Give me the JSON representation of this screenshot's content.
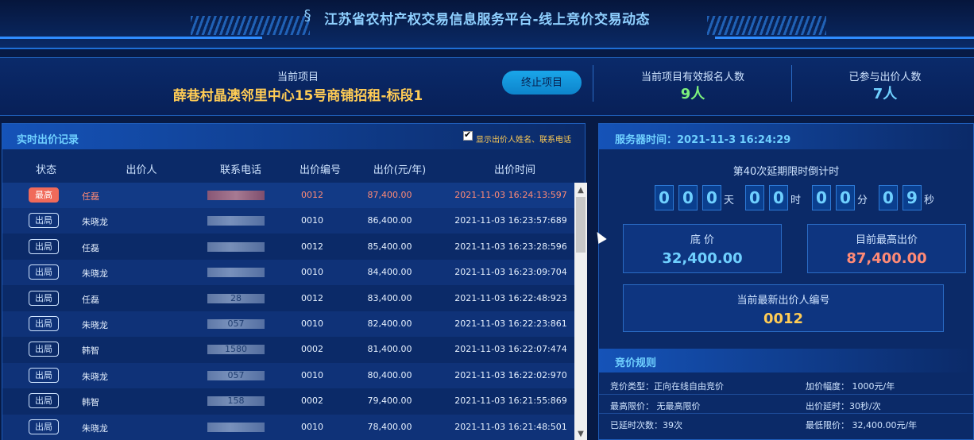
{
  "header": {
    "title": "江苏省农村产权交易信息服务平台-线上竞价交易动态",
    "logo_icon": "s-logo-icon"
  },
  "project": {
    "label": "当前项目",
    "name": "薛巷村晶澳邻里中心15号商铺招租-标段1",
    "end_button": "终止项目",
    "registered_label": "当前项目有效报名人数",
    "registered_value": "9人",
    "bidders_label": "已参与出价人数",
    "bidders_value": "7人"
  },
  "bids": {
    "title": "实时出价记录",
    "show_checkbox_label": "显示出价人姓名、联系电话",
    "columns": [
      "状态",
      "出价人",
      "联系电话",
      "出价编号",
      "出价(元/年)",
      "出价时间"
    ],
    "rows": [
      {
        "status": "最高",
        "bidder": "任磊",
        "phone": "",
        "code": "0012",
        "price": "87,400.00",
        "time": "2021-11-03 16:24:13:597"
      },
      {
        "status": "出局",
        "bidder": "朱晓龙",
        "phone": "",
        "code": "0010",
        "price": "86,400.00",
        "time": "2021-11-03 16:23:57:689"
      },
      {
        "status": "出局",
        "bidder": "任磊",
        "phone": "",
        "code": "0012",
        "price": "85,400.00",
        "time": "2021-11-03 16:23:28:596"
      },
      {
        "status": "出局",
        "bidder": "朱晓龙",
        "phone": "",
        "code": "0010",
        "price": "84,400.00",
        "time": "2021-11-03 16:23:09:704"
      },
      {
        "status": "出局",
        "bidder": "任磊",
        "phone": "28",
        "code": "0012",
        "price": "83,400.00",
        "time": "2021-11-03 16:22:48:923"
      },
      {
        "status": "出局",
        "bidder": "朱晓龙",
        "phone": "057",
        "code": "0010",
        "price": "82,400.00",
        "time": "2021-11-03 16:22:23:861"
      },
      {
        "status": "出局",
        "bidder": "韩智",
        "phone": "1580",
        "code": "0002",
        "price": "81,400.00",
        "time": "2021-11-03 16:22:07:474"
      },
      {
        "status": "出局",
        "bidder": "朱晓龙",
        "phone": "057",
        "code": "0010",
        "price": "80,400.00",
        "time": "2021-11-03 16:22:02:970"
      },
      {
        "status": "出局",
        "bidder": "韩智",
        "phone": "158",
        "code": "0002",
        "price": "79,400.00",
        "time": "2021-11-03 16:21:55:869"
      },
      {
        "status": "出局",
        "bidder": "朱晓龙",
        "phone": "",
        "code": "0010",
        "price": "78,400.00",
        "time": "2021-11-03 16:21:48:501"
      }
    ]
  },
  "server": {
    "time": "服务器时间：2021-11-3 16:24:29",
    "countdown_label": "第40次延期限时倒计时",
    "digits": [
      "0",
      "0",
      "0",
      "0",
      "0",
      "0",
      "0",
      "0",
      "9"
    ],
    "units": [
      "天",
      "时",
      "分",
      "秒"
    ],
    "base_price_label": "底 价",
    "base_price": "32,400.00",
    "highest_label": "目前最高出价",
    "highest": "87,400.00",
    "latest_bidder_label": "当前最新出价人编号",
    "latest_bidder": "0012"
  },
  "rules": {
    "title": "竞价规则",
    "items": [
      "竞价类型：正向在线自由竞价",
      "加价幅度： 1000元/年",
      "最高限价： 无最高限价",
      "出价延时：30秒/次",
      "已延时次数：39次",
      "最低限价： 32,400.00元/年"
    ]
  },
  "colors": {
    "accent": "#6fd0ff",
    "gold": "#ffcc55",
    "red": "#ff8a76",
    "green": "#7cf07c"
  }
}
